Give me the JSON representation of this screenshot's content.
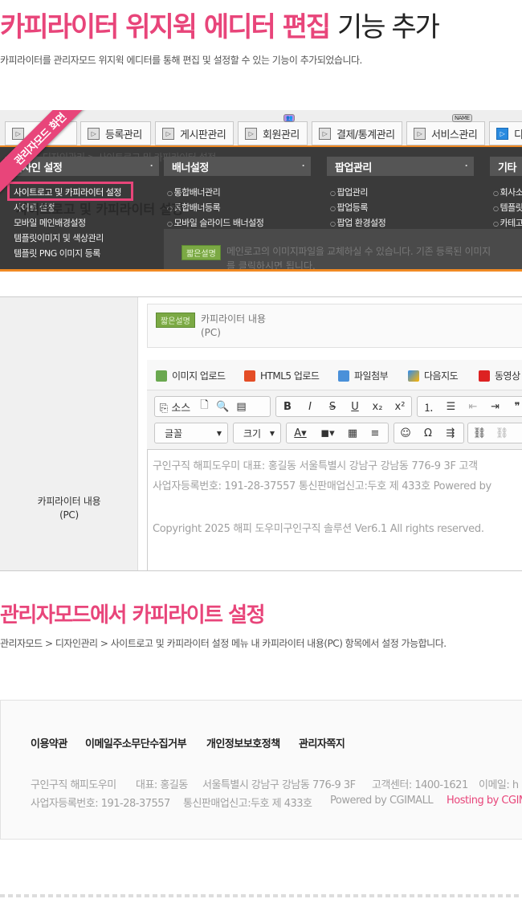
{
  "title": {
    "pink": "카피라이터 위지윅 에디터 편집",
    "dark": "기능 추가"
  },
  "intro": "카피라이터를 관리자모드 위지윅 에디터를 통해 편집 및 설정할 수 있는 기능이 추가되었습니다.",
  "shot1": {
    "ribbon": "관리자모드 화면",
    "tabs": [
      "",
      "등록관리",
      "게시판관리",
      "회원관리",
      "결제/통계관리",
      "서비스관리",
      "디"
    ],
    "breadcrumb": "> 디자인관리 > 사이트로고 및 카피라이터 설정",
    "menu_headers": [
      "디자인 설정",
      "배너설정",
      "팝업관리",
      "기타"
    ],
    "col1": [
      "사이트로고 및 카피라이터 설정",
      "사이트 설정",
      "모바일 메인배경설정",
      "템플릿이미지 및 색상관리",
      "템플릿 PNG 이미지 등록"
    ],
    "col2": [
      "통합배너관리",
      "통합배너등록",
      "모바일 슬라이드 배너설정"
    ],
    "col3": [
      "팝업관리",
      "팝업등록",
      "팝업 환경설정"
    ],
    "col4": [
      "회사소",
      "템플릿",
      "카테고"
    ],
    "page_title": "사이트로고 및 카피라이터 설정",
    "tag": "짧은설명",
    "desc_line1": "메인로고의 이미지파일을 교체하실 수 있습니다. 기존 등록된 이미지",
    "desc_line2": "를 클릭하시면 됩니다."
  },
  "shot2": {
    "label_line1": "카피라이터 내용",
    "label_line2": "(PC)",
    "tag": "짧은설명",
    "desc_line1": "카피라이터 내용",
    "desc_line2": "(PC)",
    "upload_buttons": [
      "이미지 업로드",
      "HTML5 업로드",
      "파일첨부",
      "다음지도",
      "동영상"
    ],
    "source_label": "소스",
    "font_label": "글꼴",
    "size_label": "크기",
    "editor_line1": "구인구직 해피도우미     대표: 홍길동     서울특별시 강남구 강남동 776-9 3F     고객",
    "editor_line2": "사업자등록번호: 191-28-37557     통신판매업신고:두호 제 433호     Powered by",
    "editor_line3": "Copyright 2025 해피 도우미구인구직 솔루션 Ver6.1 All rights reserved."
  },
  "section2": {
    "title": "관리자모드에서 카피라이트 설정",
    "text": "관리자모드 > 디자인관리 > 사이트로고 및 카피라이터 설정 메뉴 내 카피라이터 내용(PC) 항목에서 설정 가능합니다."
  },
  "footer": {
    "links": [
      "이용약관",
      "이메일주소무단수집거부",
      "개인정보보호정책",
      "관리자쪽지"
    ],
    "info1": [
      "구인구직 해피도우미",
      "대표: 홍길동",
      "서울특별시 강남구 강남동 776-9 3F",
      "고객센터: 1400-1621",
      "이메일: h"
    ],
    "info2": [
      "사업자등록번호: 191-28-37557",
      "통신판매업신고:두호 제 433호",
      "Powered by CGIMALL"
    ],
    "hosting": "Hosting by CGIM"
  },
  "colors": {
    "accent": "#e8457a",
    "orange": "#f08a24",
    "tag_green": "#7ba944"
  }
}
